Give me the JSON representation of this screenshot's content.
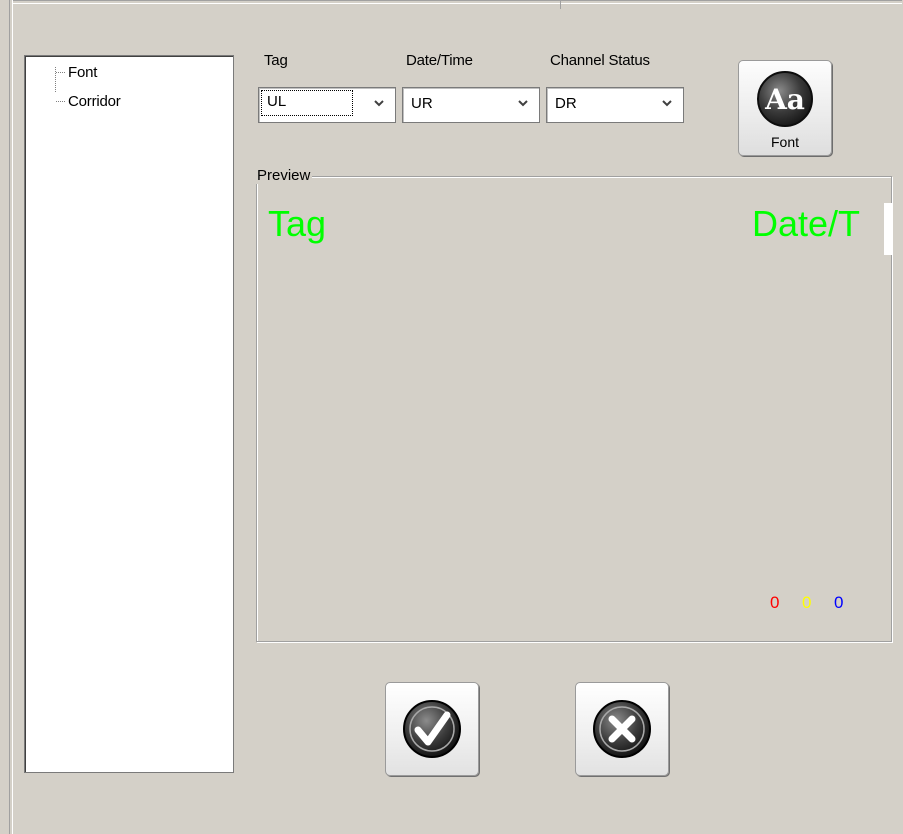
{
  "tree": {
    "items": [
      {
        "label": "Font"
      },
      {
        "label": "Corridor"
      }
    ]
  },
  "fields": {
    "tag": {
      "label": "Tag",
      "value": "UL"
    },
    "datetime": {
      "label": "Date/Time",
      "value": "UR"
    },
    "channel_status": {
      "label": "Channel Status",
      "value": "DR"
    }
  },
  "font_button": {
    "label": "Font",
    "glyph": "Aa",
    "icon": "font-aa-icon"
  },
  "preview": {
    "title": "Preview",
    "tag_text": "Tag",
    "datetime_text": "Date/T",
    "text_color": "#00ff00",
    "channels": [
      {
        "value": "0",
        "color": "#ff0000"
      },
      {
        "value": "0",
        "color": "#ffff00"
      },
      {
        "value": "0",
        "color": "#0000ff"
      }
    ]
  },
  "buttons": {
    "ok_icon": "checkmark-icon",
    "cancel_icon": "close-icon"
  }
}
